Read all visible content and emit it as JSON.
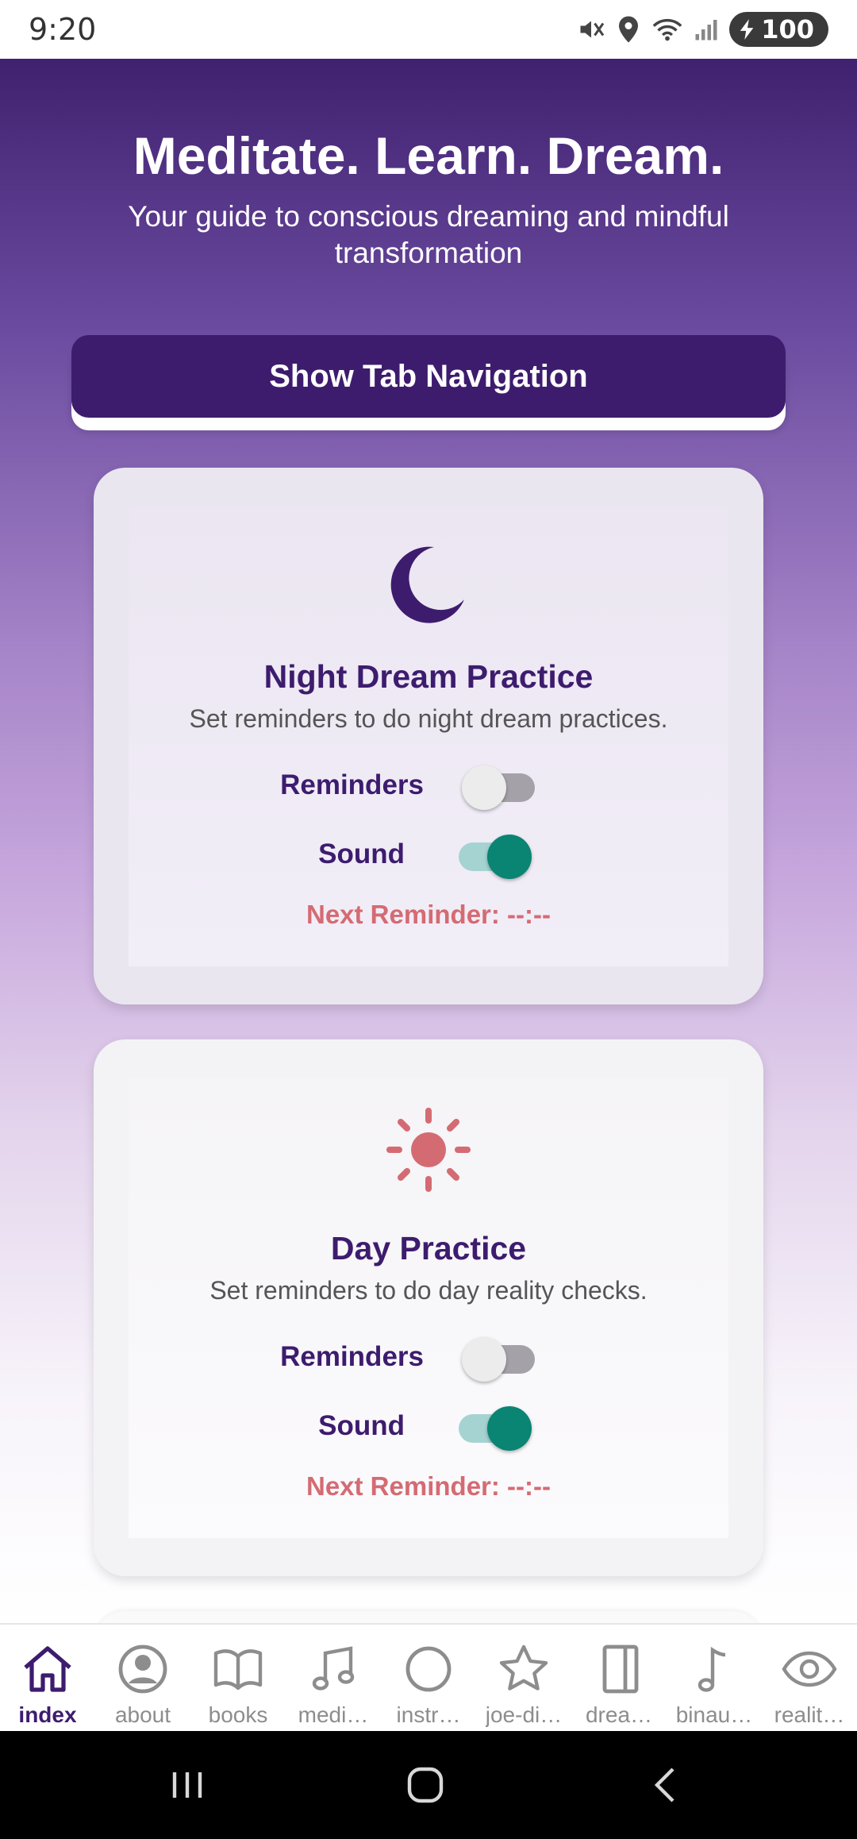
{
  "status_bar": {
    "time": "9:20",
    "battery": "100",
    "icons": [
      "mute-icon",
      "location-icon",
      "wifi-icon",
      "signal-icon",
      "battery-icon"
    ]
  },
  "hero": {
    "title": "Meditate. Learn. Dream.",
    "subtitle": "Your guide to conscious dreaming and mindful transformation"
  },
  "tab_nav_button": "Show Tab Navigation",
  "cards": [
    {
      "icon": "moon-icon",
      "title": "Night Dream Practice",
      "description": "Set reminders to do night dream practices.",
      "reminders_label": "Reminders",
      "reminders_on": false,
      "sound_label": "Sound",
      "sound_on": true,
      "next_reminder": "Next Reminder: --:--"
    },
    {
      "icon": "sun-icon",
      "title": "Day Practice",
      "description": "Set reminders to do day reality checks.",
      "reminders_label": "Reminders",
      "reminders_on": false,
      "sound_label": "Sound",
      "sound_on": true,
      "next_reminder": "Next Reminder: --:--"
    }
  ],
  "tabs": [
    {
      "label": "index",
      "icon": "home-icon",
      "active": true
    },
    {
      "label": "about",
      "icon": "person-circle-icon",
      "active": false
    },
    {
      "label": "books",
      "icon": "book-icon",
      "active": false
    },
    {
      "label": "medi…",
      "icon": "music-notes-icon",
      "active": false
    },
    {
      "label": "instr…",
      "icon": "circle-icon",
      "active": false
    },
    {
      "label": "joe-di…",
      "icon": "star-icon",
      "active": false
    },
    {
      "label": "drea…",
      "icon": "journal-icon",
      "active": false
    },
    {
      "label": "binau…",
      "icon": "music-note-icon",
      "active": false
    },
    {
      "label": "realit…",
      "icon": "eye-icon",
      "active": false
    }
  ],
  "colors": {
    "brand_purple": "#3d1c6e",
    "accent_coral": "#d46b73",
    "toggle_on": "#0a8473"
  }
}
